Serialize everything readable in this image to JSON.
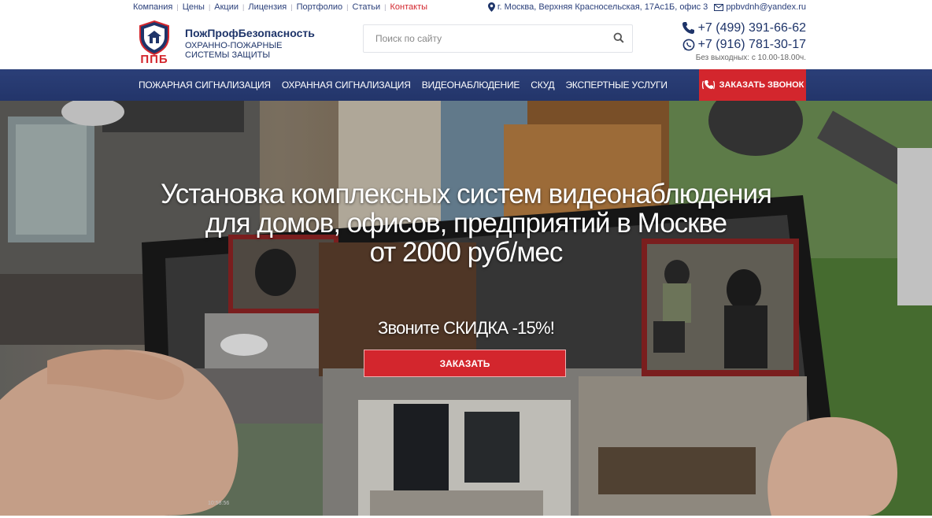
{
  "topbar": {
    "links": [
      {
        "label": "Компания"
      },
      {
        "label": "Цены"
      },
      {
        "label": "Акции"
      },
      {
        "label": "Лицензия"
      },
      {
        "label": "Портфолио"
      },
      {
        "label": "Статьи"
      },
      {
        "label": "Контакты",
        "active": true
      }
    ],
    "address": "г. Москва, Верхняя Красносельская, 17Ас1Б, офис 3",
    "email": "ppbvdnh@yandex.ru",
    "address_icon": "map-pin-icon",
    "email_icon": "envelope-icon"
  },
  "header": {
    "logo_text": "ППБ",
    "brand_name": "ПожПрофБезопасность",
    "brand_sub": "ОХРАННО-ПОЖАРНЫЕ СИСТЕМЫ ЗАЩИТЫ",
    "search_placeholder": "Поиск по сайту",
    "phone1": "+7 (499) 391-66-62",
    "phone2": "+7 (916) 781-30-17",
    "hours": "Без выходных: с 10.00-18.00ч.",
    "phone1_icon": "phone-icon",
    "phone2_icon": "whatsapp-icon"
  },
  "nav": {
    "items": [
      {
        "label": "Пожарная сигнализация"
      },
      {
        "label": "Охранная сигнализация"
      },
      {
        "label": "Видеонаблюдение"
      },
      {
        "label": "СКУД"
      },
      {
        "label": "Экспертные услуги"
      }
    ],
    "callback_label": "Заказать звонок",
    "callback_icon": "phone-ringing-icon"
  },
  "hero": {
    "title_line1": "Установка комплексных систем видеонаблюдения",
    "title_line2": "для домов, офисов, предприятий в Москве",
    "title_line3": "от 2000 руб/мес",
    "promo": "Звоните СКИДКА -15%!",
    "order_label": "Заказать",
    "screen_timestamp": "10:58:56"
  },
  "colors": {
    "brand_blue": "#1e3469",
    "nav_blue": "#2b3f78",
    "accent_red": "#d3262d"
  }
}
